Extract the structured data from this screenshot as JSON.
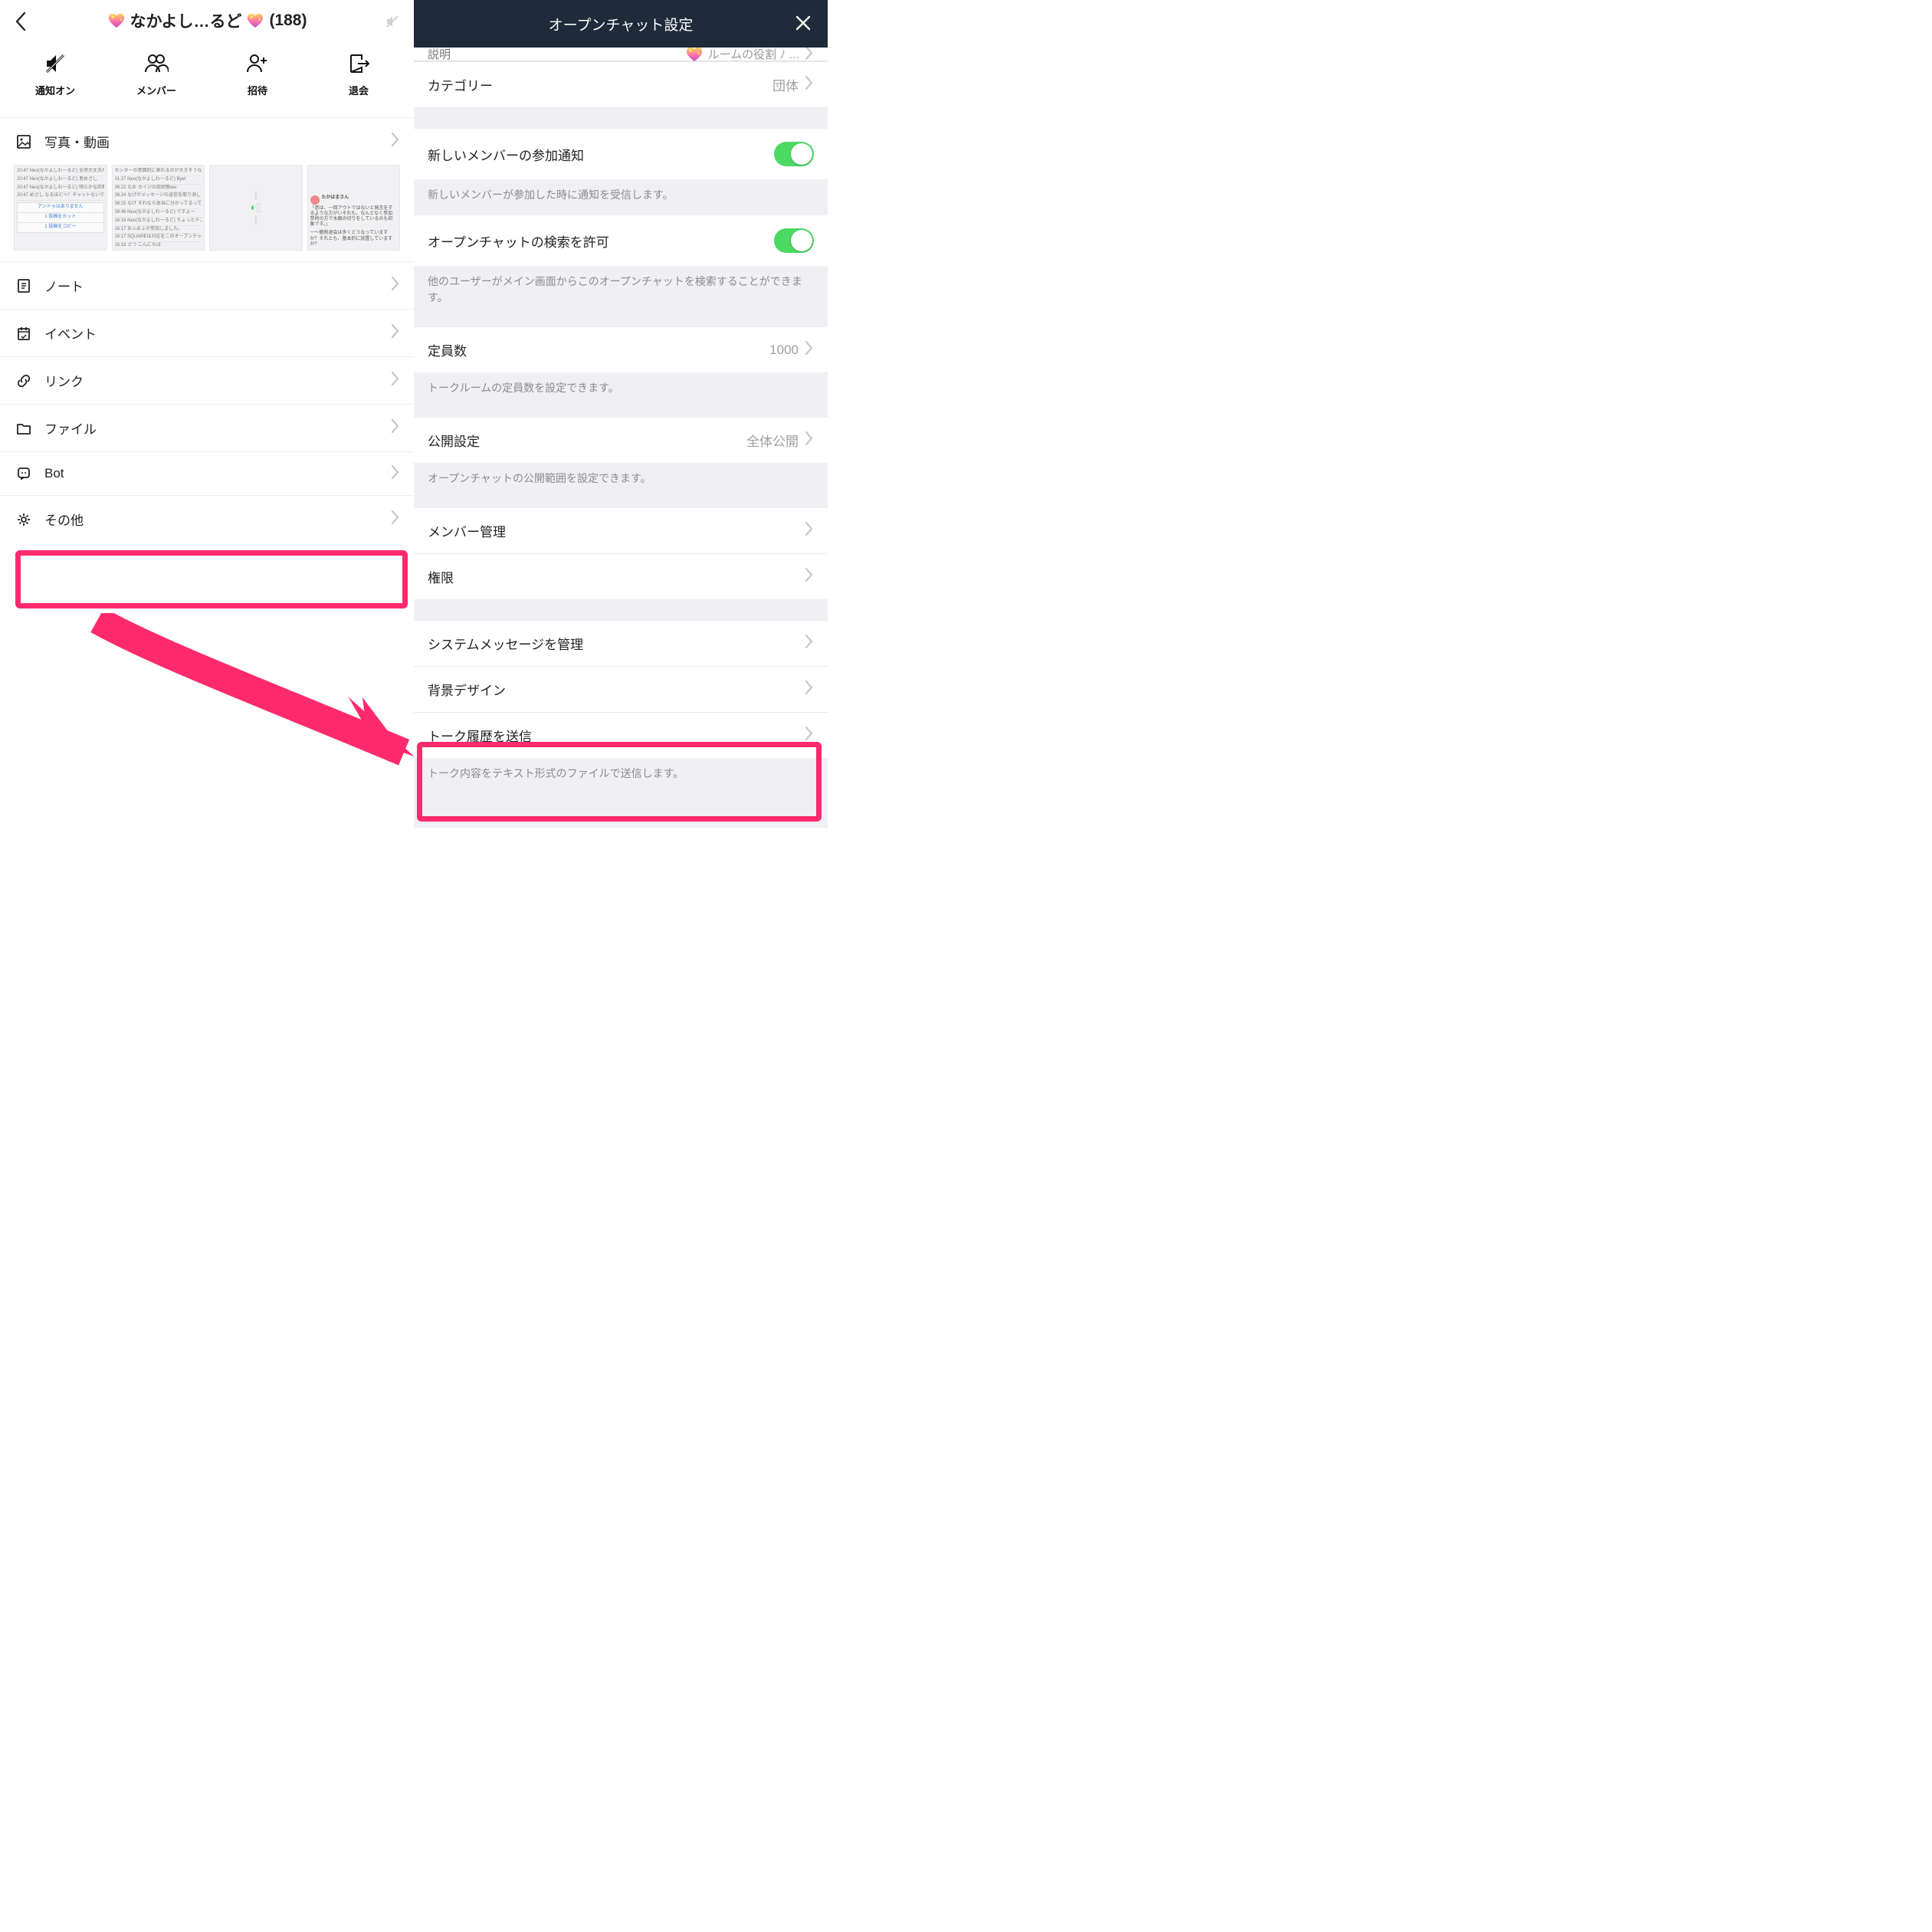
{
  "left": {
    "title_middle": "なかよし…るど",
    "count": "(188)",
    "actions": {
      "notify": "通知オン",
      "members": "メンバー",
      "invite": "招待",
      "leave": "退会"
    },
    "sections": {
      "photos": "写真・動画",
      "notes": "ノート",
      "events": "イベント",
      "links": "リンク",
      "files": "ファイル",
      "bot": "Bot",
      "other": "その他"
    },
    "thumbs": {
      "t1": {
        "l1": "20:47 Neo(なかよしわーるど) 全然大丈夫だと思いますよ",
        "l2": "20:47 Neo(なかよしわーるど) 皆めざし",
        "l3": "20:47 Neo(なかよしわーるど) 明らかな詐欺だと確認されたら分からないですけど",
        "l4": "20:47 めざし なるほど〜！チャットないでも言及が",
        "b1": "アンドゥはありません",
        "b2": "1 投稿をカット",
        "b3": "1 投稿をコピー"
      },
      "t2": {
        "l1": "センターの意図的に表れるのが大きそうな",
        "l2": "01:27 Neo(なかよしわーるど) Bye!",
        "l3": "06:22 なお カイジの説状態ww",
        "l4": "08:24 なげがメッセージの送信を取り消しました",
        "l5": "08:25 なげ それなら本当に分かってるってやつですか",
        "l6": "08:46 Neo(なかよしわーるど) ですよー",
        "l7": "16:16 Neo(なかよしわーるど) ちょっとテスト",
        "l8": "16:17 おふおふが参加しました。",
        "l9": "16:17 SQUAREは対応をこのオープンチャットから退会させました。",
        "l10": "16:18 さつ こんにちは",
        "l11": "16:18 Neo(なかよしわーるど) こんにちは",
        "l12": "16:19 Neo(なかよしわーるど) ロゴもちゃんと変わるようになったかきがする",
        "l13": "16:20 らへ〜 新メンバーさん入ってきた時、す"
      },
      "t4": {
        "name": "たかはまさん",
        "l1": "「意は、一回アウトではないと発言をするような方がいそれも、なんとなく参加禁則の方で水銀の切りをしているのも印象です。」",
        "l2": "一〜撤削退会は多くどうなっていますか？それとも、基本的に放置していますか？"
      }
    }
  },
  "right": {
    "header": "オープンチャット設定",
    "peek_label": "説明",
    "peek_value": "ルームの役割 ﾉ …",
    "rows": {
      "category_label": "カテゴリー",
      "category_value": "団体",
      "notify_new": "新しいメンバーの参加通知",
      "notify_new_desc": "新しいメンバーが参加した時に通知を受信します。",
      "allow_search": "オープンチャットの検索を許可",
      "allow_search_desc": "他のユーザーがメイン画面からこのオープンチャットを検索することができます。",
      "capacity_label": "定員数",
      "capacity_value": "1000",
      "capacity_desc": "トークルームの定員数を設定できます。",
      "visibility_label": "公開設定",
      "visibility_value": "全体公開",
      "visibility_desc": "オープンチャットの公開範囲を設定できます。",
      "member_mgmt": "メンバー管理",
      "permissions": "権限",
      "sys_msg": "システムメッセージを管理",
      "bg_design": "背景デザイン",
      "send_history": "トーク履歴を送信",
      "send_history_desc": "トーク内容をテキスト形式のファイルで送信します。"
    }
  }
}
